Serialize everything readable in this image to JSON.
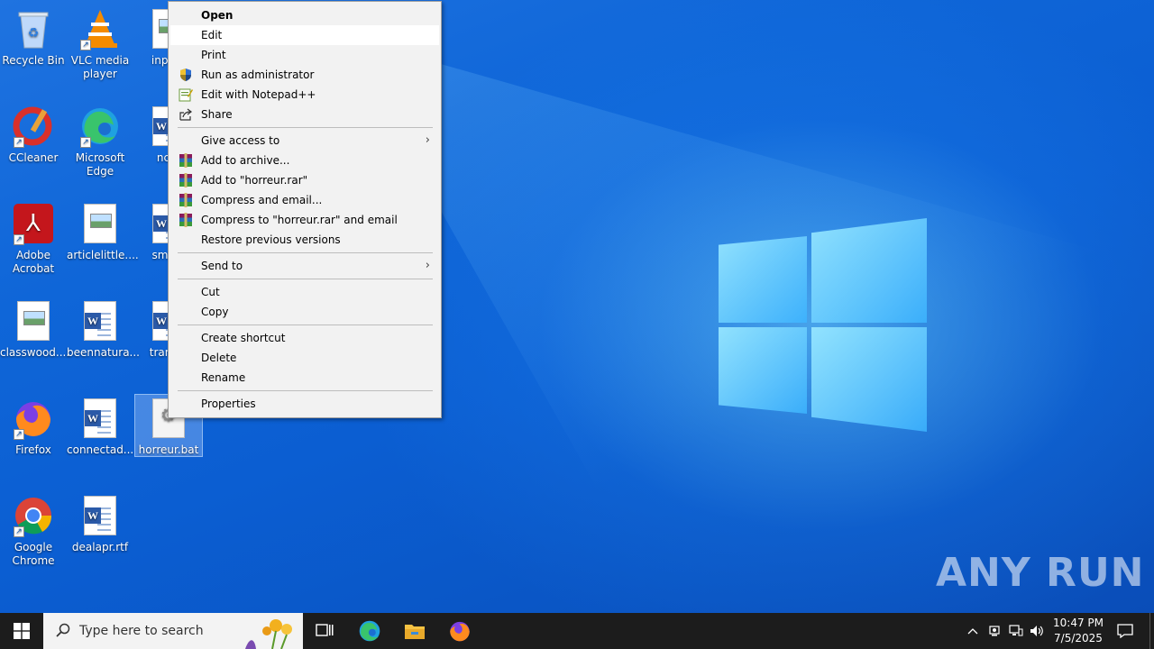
{
  "desktop": {
    "icons": [
      {
        "label": "Recycle Bin"
      },
      {
        "label": "VLC media player"
      },
      {
        "label": "inputo"
      },
      {
        "label": "CCleaner"
      },
      {
        "label": "Microsoft Edge"
      },
      {
        "label": "ncta"
      },
      {
        "label": "Adobe Acrobat"
      },
      {
        "label": "articlelittle...."
      },
      {
        "label": "smithl"
      },
      {
        "label": "classwood...."
      },
      {
        "label": "beennatura..."
      },
      {
        "label": "transfe"
      },
      {
        "label": "Firefox"
      },
      {
        "label": "connectad..."
      },
      {
        "label": "horreur.bat"
      },
      {
        "label": "Google Chrome"
      },
      {
        "label": "dealapr.rtf"
      }
    ]
  },
  "context_menu": {
    "items": [
      {
        "label": "Open"
      },
      {
        "label": "Edit"
      },
      {
        "label": "Print"
      },
      {
        "label": "Run as administrator",
        "icon": "shield-icon"
      },
      {
        "label": "Edit with Notepad++",
        "icon": "notepadpp-icon"
      },
      {
        "label": "Share",
        "icon": "share-icon"
      },
      {
        "label": "Give access to"
      },
      {
        "label": "Add to archive...",
        "icon": "winrar-icon"
      },
      {
        "label": "Add to \"horreur.rar\"",
        "icon": "winrar-icon"
      },
      {
        "label": "Compress and email...",
        "icon": "winrar-icon"
      },
      {
        "label": "Compress to \"horreur.rar\" and email",
        "icon": "winrar-icon"
      },
      {
        "label": "Restore previous versions"
      },
      {
        "label": "Send to"
      },
      {
        "label": "Cut"
      },
      {
        "label": "Copy"
      },
      {
        "label": "Create shortcut"
      },
      {
        "label": "Delete"
      },
      {
        "label": "Rename"
      },
      {
        "label": "Properties"
      }
    ]
  },
  "taskbar": {
    "search_placeholder": "Type here to search",
    "clock_time": "10:47 PM",
    "clock_date": "7/5/2025"
  },
  "watermark": "ANY RUN",
  "colors": {
    "desktop_blue": "#0b5ed2",
    "taskbar": "#1c1c1c",
    "menu_bg": "#f2f2f2"
  }
}
